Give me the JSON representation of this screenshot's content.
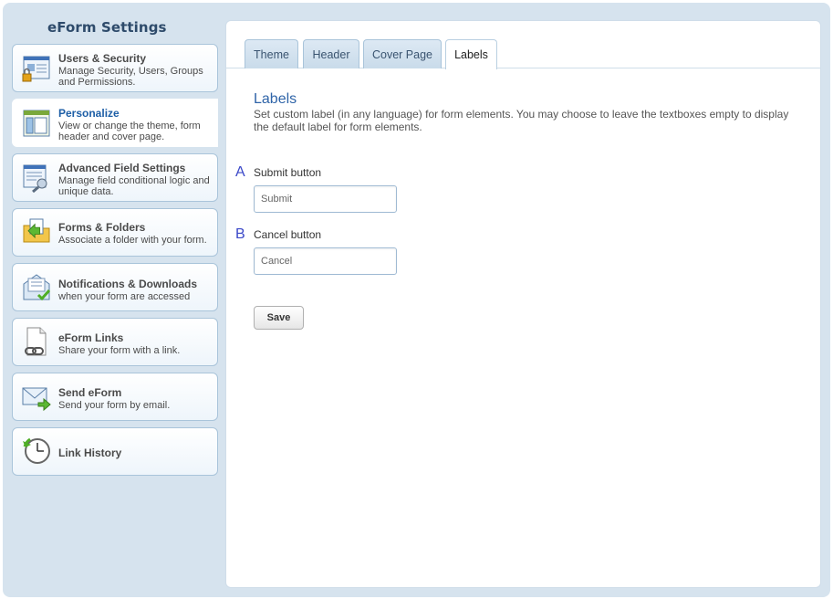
{
  "sidebar": {
    "title": "eForm Settings",
    "items": [
      {
        "label": "Users & Security",
        "desc": "Manage Security, Users, Groups and Permissions.",
        "icon": "users-security-icon"
      },
      {
        "label": "Personalize",
        "desc": "View or change the theme, form header and cover page.",
        "icon": "personalize-icon",
        "active": true
      },
      {
        "label": "Advanced Field Settings",
        "desc": "Manage field conditional logic and unique data.",
        "icon": "advanced-settings-icon"
      },
      {
        "label": "Forms & Folders",
        "desc": "Associate a folder with your form.",
        "icon": "folder-icon"
      },
      {
        "label": "Notifications & Downloads",
        "desc": "when your form are accessed",
        "icon": "notification-icon"
      },
      {
        "label": "eForm Links",
        "desc": "Share your form with a link.",
        "icon": "link-icon"
      },
      {
        "label": "Send eForm",
        "desc": "Send your form by email.",
        "icon": "email-icon"
      },
      {
        "label": "Link History",
        "desc": "",
        "icon": "clock-icon"
      }
    ]
  },
  "tabs": [
    {
      "label": "Theme"
    },
    {
      "label": "Header"
    },
    {
      "label": "Cover Page"
    },
    {
      "label": "Labels",
      "active": true
    }
  ],
  "labels_section": {
    "title": "Labels",
    "description": "Set custom label (in any language) for form elements. You may choose to leave the textboxes empty to display the default label for form elements.",
    "fields": [
      {
        "marker": "A",
        "label": "Submit button",
        "placeholder": "Submit"
      },
      {
        "marker": "B",
        "label": "Cancel button",
        "placeholder": "Cancel"
      }
    ],
    "save_label": "Save"
  },
  "colors": {
    "frame": "#d6e3ee",
    "accent": "#2f64a8",
    "marker": "#3b48c8",
    "tab": "#c9dbea"
  }
}
